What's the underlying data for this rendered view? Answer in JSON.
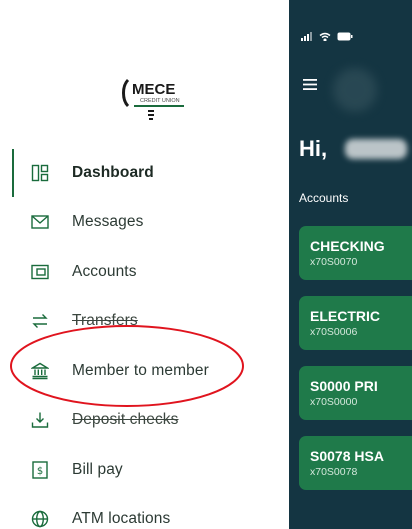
{
  "drawer": {
    "logo": {
      "text": "MECE",
      "subtext": "CREDIT UNION"
    },
    "items": [
      {
        "label": "Dashboard",
        "icon": "dashboard-grid-icon",
        "active": true,
        "strike": false
      },
      {
        "label": "Messages",
        "icon": "envelope-icon",
        "active": false,
        "strike": false
      },
      {
        "label": "Accounts",
        "icon": "accounts-card-icon",
        "active": false,
        "strike": false
      },
      {
        "label": "Transfers",
        "icon": "transfer-arrows-icon",
        "active": false,
        "strike": true
      },
      {
        "label": "Member to member",
        "icon": "bank-building-icon",
        "active": false,
        "strike": false
      },
      {
        "label": "Deposit checks",
        "icon": "deposit-download-icon",
        "active": false,
        "strike": true
      },
      {
        "label": "Bill pay",
        "icon": "dollar-doc-icon",
        "active": false,
        "strike": false
      },
      {
        "label": "ATM locations",
        "icon": "globe-icon",
        "active": false,
        "strike": false
      }
    ]
  },
  "app": {
    "greeting": "Hi,",
    "section_label": "Accounts",
    "cards": [
      {
        "name": "CHECKING",
        "number": "x70S0070"
      },
      {
        "name": "ELECTRIC",
        "number": "x70S0006"
      },
      {
        "name": "S0000 PRI",
        "number": "x70S0000"
      },
      {
        "name": "S0078 HSA",
        "number": "x70S0078"
      }
    ]
  },
  "colors": {
    "brand_green": "#1a6b3c",
    "card_green": "#1f7a4a",
    "app_background": "#143542",
    "annotation_red": "#e0141e"
  }
}
